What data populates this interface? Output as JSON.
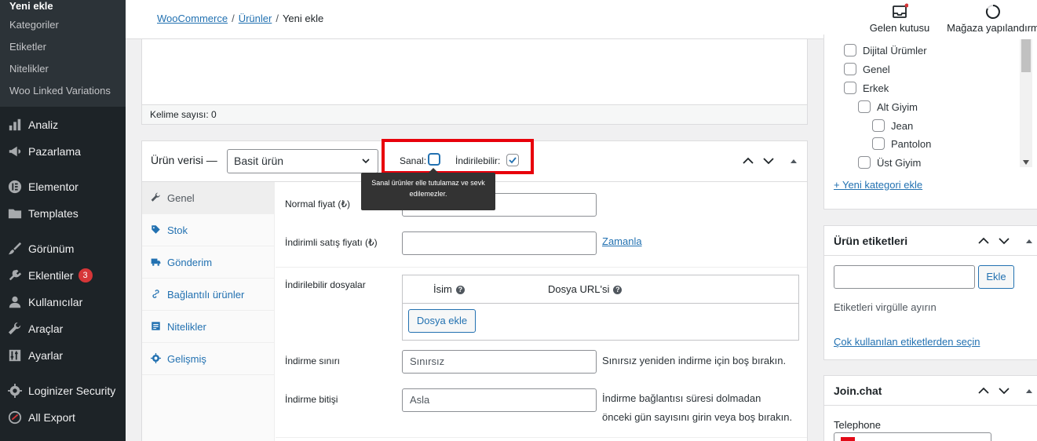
{
  "sidebar": {
    "submenu": [
      {
        "label": "Yeni ekle",
        "current": true
      },
      {
        "label": "Kategoriler"
      },
      {
        "label": "Etiketler"
      },
      {
        "label": "Nitelikler"
      },
      {
        "label": "Woo Linked Variations"
      }
    ],
    "menu": [
      {
        "label": "Analiz",
        "icon": "bar-chart-icon"
      },
      {
        "label": "Pazarlama",
        "icon": "megaphone-icon"
      },
      {
        "label": "Elementor",
        "icon": "elementor-icon"
      },
      {
        "label": "Templates",
        "icon": "folder-icon"
      },
      {
        "label": "Görünüm",
        "icon": "paintbrush-icon"
      },
      {
        "label": "Eklentiler",
        "icon": "plugin-icon",
        "badge": "3"
      },
      {
        "label": "Kullanıcılar",
        "icon": "user-icon"
      },
      {
        "label": "Araçlar",
        "icon": "wrench-icon"
      },
      {
        "label": "Ayarlar",
        "icon": "settings-sliders-icon"
      },
      {
        "label": "Loginizer Security",
        "icon": "gear-icon"
      },
      {
        "label": "All Export",
        "icon": "export-icon"
      }
    ]
  },
  "topbar": {
    "breadcrumb": {
      "root": "WooCommerce",
      "parent": "Ürünler",
      "current": "Yeni ekle",
      "separator": "/"
    },
    "inbox_label": "Gelen kutusu",
    "store_setup_label": "Mağaza yapılandırm"
  },
  "editor": {
    "word_count": "Kelime sayısı: 0"
  },
  "product_data": {
    "title": "Ürün verisi —",
    "type_value": "Basit ürün",
    "virtual_label": "Sanal:",
    "virtual_checked": false,
    "downloadable_label": "İndirilebilir:",
    "downloadable_checked": true,
    "tooltip": "Sanal ürünler elle tutulamaz ve sevk edilemezler.",
    "tabs": [
      {
        "label": "Genel",
        "icon": "wrench-icon",
        "active": true
      },
      {
        "label": "Stok",
        "icon": "tag-icon"
      },
      {
        "label": "Gönderim",
        "icon": "truck-icon"
      },
      {
        "label": "Bağlantılı ürünler",
        "icon": "link-icon"
      },
      {
        "label": "Nitelikler",
        "icon": "list-icon"
      },
      {
        "label": "Gelişmiş",
        "icon": "gear-icon"
      }
    ],
    "regular_price_label": "Normal fiyat (₺)",
    "sale_price_label": "İndirimli satış fiyatı (₺)",
    "schedule_link": "Zamanla",
    "downloadable_files_label": "İndirilebilir dosyalar",
    "files_table": {
      "col_name": "İsim",
      "col_url": "Dosya URL'si",
      "add_button": "Dosya ekle"
    },
    "download_limit_label": "İndirme sınırı",
    "download_limit_placeholder": "Sınırsız",
    "download_limit_help": "Sınırsız yeniden indirme için boş bırakın.",
    "download_expiry_label": "İndirme bitişi",
    "download_expiry_placeholder": "Asla",
    "download_expiry_help_1": "İndirme bağlantısı süresi dolmadan",
    "download_expiry_help_2": "önceki gün sayısını girin veya boş bırakın."
  },
  "categories": {
    "items": [
      {
        "label": "Dijital Ürümler",
        "level": 0
      },
      {
        "label": "Genel",
        "level": 0
      },
      {
        "label": "Erkek",
        "level": 0
      },
      {
        "label": "Alt Giyim",
        "level": 1
      },
      {
        "label": "Jean",
        "level": 2
      },
      {
        "label": "Pantolon",
        "level": 2
      },
      {
        "label": "Üst Giyim",
        "level": 1
      }
    ],
    "add_link": "+ Yeni kategori ekle"
  },
  "tags": {
    "title": "Ürün etiketleri",
    "add_button": "Ekle",
    "help": "Etiketleri virgülle ayırın",
    "popular_link": "Çok kullanılan etiketlerden seçin"
  },
  "joinchat": {
    "title": "Join.chat",
    "telephone_label": "Telephone"
  }
}
